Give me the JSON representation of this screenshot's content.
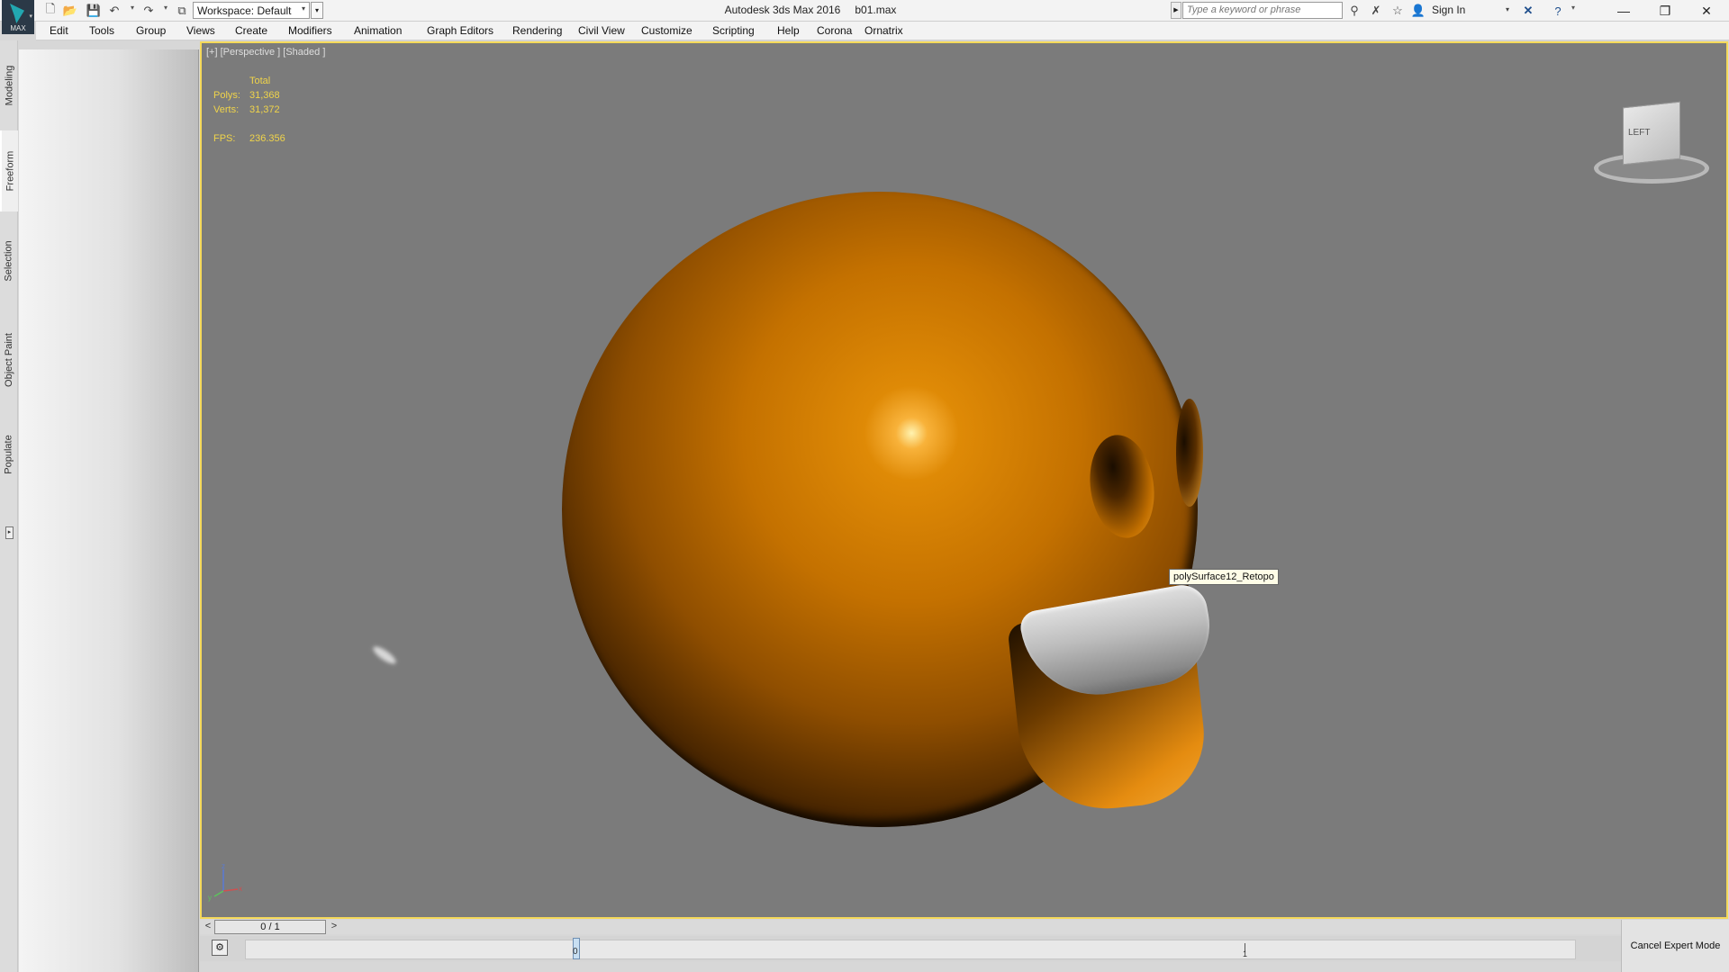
{
  "titlebar": {
    "app_name": "Autodesk 3ds Max 2016",
    "file_name": "b01.max",
    "logo_text": "MAX",
    "workspace": "Workspace: Default",
    "search_placeholder": "Type a keyword or phrase",
    "sign_in": "Sign In"
  },
  "menu": [
    "Edit",
    "Tools",
    "Group",
    "Views",
    "Create",
    "Modifiers",
    "Animation",
    "Graph Editors",
    "Rendering",
    "Civil View",
    "Customize",
    "Scripting",
    "Help",
    "Corona",
    "Ornatrix"
  ],
  "ribbon_tabs": {
    "modeling": "Modeling",
    "freeform": "Freeform",
    "selection": "Selection",
    "object_paint": "Object Paint",
    "populate": "Populate",
    "active": "Freeform"
  },
  "viewport": {
    "label": "[+] [Perspective ] [Shaded ]",
    "stats": {
      "header": "Total",
      "polys_label": "Polys:",
      "polys": "31,368",
      "verts_label": "Verts:",
      "verts": "31,372",
      "fps_label": "FPS:",
      "fps": "236.356"
    },
    "tooltip": "polySurface12_Retopo",
    "viewcube_face": "LEFT",
    "border_color": "#f5d95a",
    "background_color": "#7b7b7b",
    "object_color": "#c47100"
  },
  "timeline": {
    "slider_prev": "<",
    "slider_next": ">",
    "slider_value": "0 / 1",
    "frame_start": "0",
    "frame_end": "1"
  },
  "expert_mode": "Cancel Expert Mode",
  "icons": [
    "new-file-icon",
    "open-file-icon",
    "save-icon",
    "undo-icon",
    "redo-icon",
    "project-icon",
    "binoculars-icon",
    "favorites-icon",
    "star-icon",
    "user-icon",
    "exchange-icon",
    "help-icon",
    "minimize-icon",
    "restore-icon",
    "close-icon"
  ]
}
